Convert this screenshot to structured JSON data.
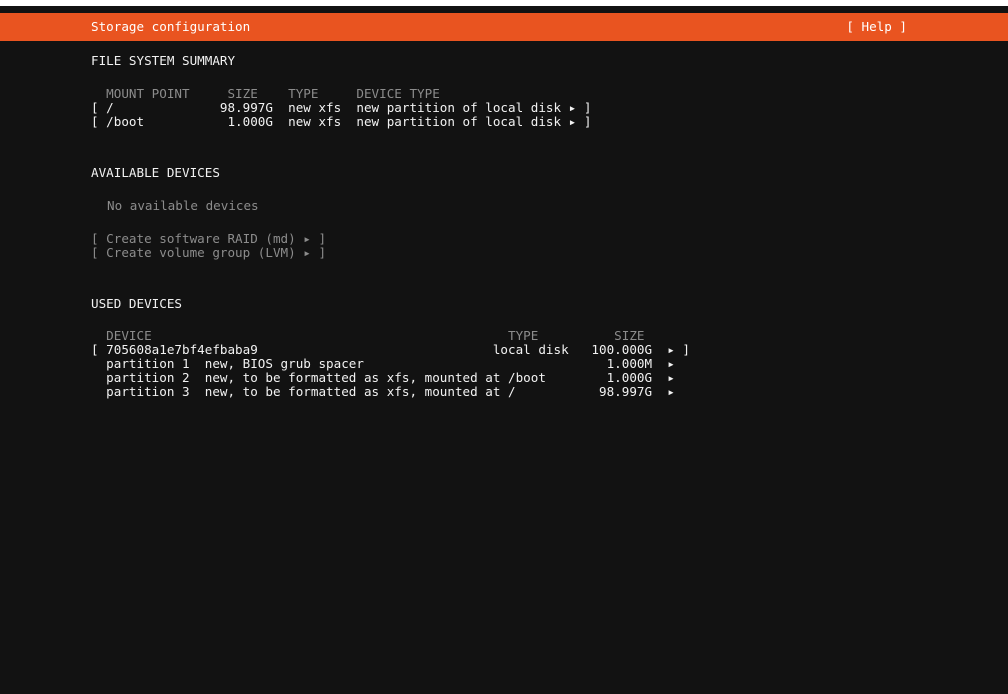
{
  "header": {
    "title": "Storage configuration",
    "help_label": "[ Help ]"
  },
  "fs_summary": {
    "heading": "FILE SYSTEM SUMMARY",
    "columns": "  MOUNT POINT     SIZE    TYPE     DEVICE TYPE",
    "rows": [
      "[ /              98.997G  new xfs  new partition of local disk ▸ ]",
      "[ /boot           1.000G  new xfs  new partition of local disk ▸ ]"
    ]
  },
  "available": {
    "heading": "AVAILABLE DEVICES",
    "empty_text": "No available devices",
    "raid_button": "[ Create software RAID (md) ▸ ]",
    "lvm_button": "[ Create volume group (LVM) ▸ ]"
  },
  "used": {
    "heading": "USED DEVICES",
    "columns": "  DEVICE                                               TYPE          SIZE",
    "rows": [
      "[ 705608a1e7bf4efbaba9                               local disk   100.000G  ▸ ]",
      "  partition 1  new, BIOS grub spacer                                1.000M  ▸",
      "  partition 2  new, to be formatted as xfs, mounted at /boot        1.000G  ▸",
      "  partition 3  new, to be formatted as xfs, mounted at /           98.997G  ▸"
    ]
  },
  "colors": {
    "accent": "#e95420",
    "background": "#121212",
    "text": "#e8e8e8",
    "dim_text": "#8c8c8c"
  }
}
